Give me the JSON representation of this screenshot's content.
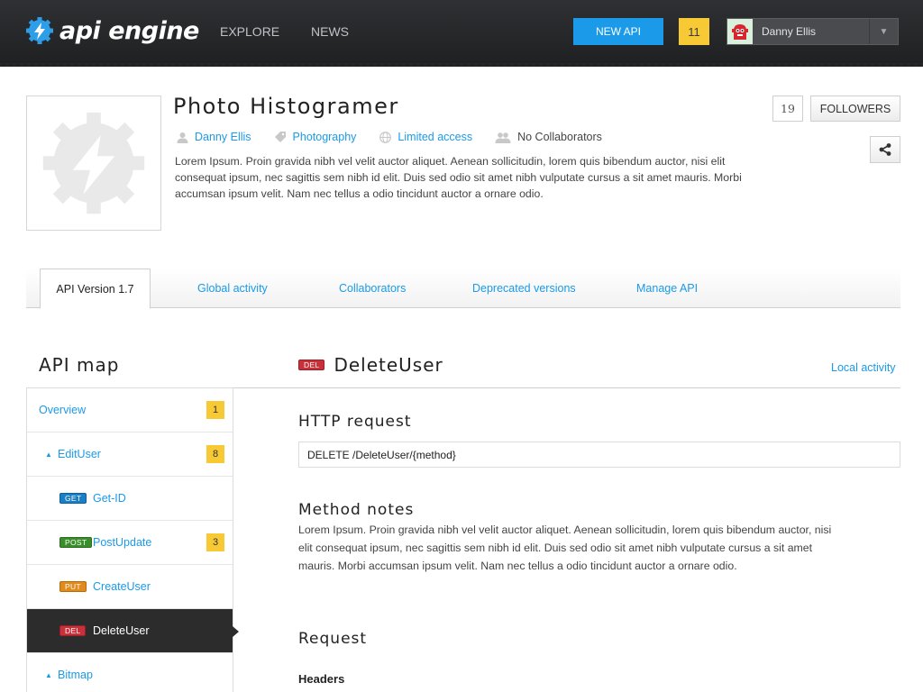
{
  "brand": {
    "name": "api engine"
  },
  "nav": {
    "explore": "EXPLORE",
    "news": "NEWS"
  },
  "toolbar": {
    "new_api": "NEW API",
    "notifications": "11"
  },
  "user": {
    "name": "Danny Ellis"
  },
  "project": {
    "title": "Photo Histogramer",
    "owner": "Danny Ellis",
    "category": "Photography",
    "access": "Limited access",
    "collaborators": "No Collaborators",
    "description": "Lorem Ipsum. Proin gravida nibh vel velit auctor aliquet. Aenean sollicitudin, lorem quis bibendum auctor, nisi elit consequat ipsum, nec sagittis sem nibh id elit. Duis sed odio sit amet nibh vulputate cursus a sit amet mauris. Morbi accumsan ipsum velit. Nam nec tellus a odio tincidunt auctor a ornare odio.",
    "followers_count": "19",
    "followers_label": "FOLLOWERS"
  },
  "tabs": [
    {
      "label": "API Version 1.7"
    },
    {
      "label": "Global activity"
    },
    {
      "label": "Collaborators"
    },
    {
      "label": "Deprecated versions"
    },
    {
      "label": "Manage API"
    }
  ],
  "api_map": {
    "title": "API map",
    "items": [
      {
        "label": "Overview",
        "count": "1"
      },
      {
        "label": "EditUser",
        "count": "8"
      },
      {
        "label": "Get-ID",
        "method": "GET"
      },
      {
        "label": "PostUpdate",
        "method": "POST",
        "count": "3"
      },
      {
        "label": "CreateUser",
        "method": "PUT"
      },
      {
        "label": "DeleteUser",
        "method": "DEL"
      },
      {
        "label": "Bitmap"
      }
    ]
  },
  "endpoint": {
    "method": "DEL",
    "name": "DeleteUser",
    "local_activity": "Local activity",
    "http_request_title": "HTTP request",
    "http_request": "DELETE /DeleteUser/{method}",
    "method_notes_title": "Method notes",
    "method_notes": "Lorem Ipsum. Proin gravida nibh vel velit auctor aliquet. Aenean sollicitudin, lorem quis bibendum auctor, nisi elit consequat ipsum, nec sagittis sem nibh id elit. Duis sed odio sit amet nibh vulputate cursus a sit amet mauris. Morbi accumsan ipsum velit. Nam nec tellus a odio tincidunt auctor a ornare odio.",
    "request_title": "Request",
    "headers_label": "Headers"
  },
  "colors": {
    "accent": "#1a9ae8",
    "badge_yellow": "#f7c934",
    "topbar": "#2a2b2e",
    "get": "#1a7fc4",
    "post": "#3a8f2c",
    "put": "#e08b1a",
    "del": "#c8303a"
  },
  "icons": {
    "logo": "gear-bolt-icon",
    "owner": "user-icon",
    "category": "tag-icon",
    "access": "globe-icon",
    "collaborators": "users-icon",
    "share": "share-icon",
    "user_menu": "chevron-down-icon"
  }
}
